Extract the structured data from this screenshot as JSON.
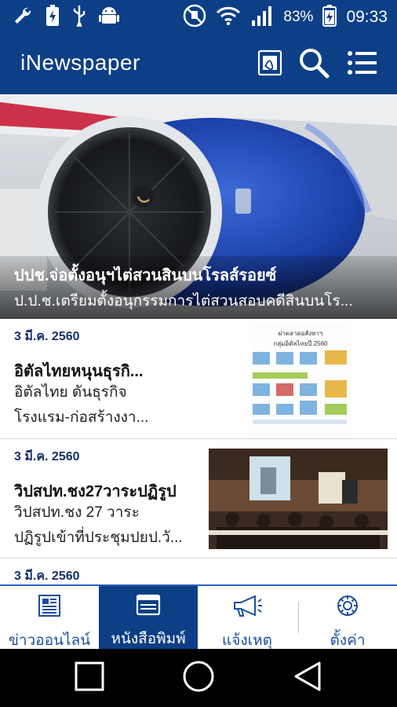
{
  "status_bar": {
    "battery_percent": "83%",
    "time": "09:33",
    "icons": [
      "wrench-icon",
      "battery-charging-icon",
      "usb-icon",
      "android-icon",
      "mute-icon",
      "wifi-icon",
      "signal-icon",
      "battery-icon"
    ]
  },
  "app_bar": {
    "title": "iNewspaper",
    "actions": [
      "pdf-icon",
      "search-icon",
      "menu-icon"
    ]
  },
  "hero": {
    "title": "ปปช.จ่อตั้งอนุฯไต่สวนสินบนโรลส์รอยซ์",
    "subtitle": "ป.ป.ช.เตรียมตั้งอนุกรรมการไต่สวนสอบคดีสินบนโร..."
  },
  "news": [
    {
      "date": "3 มี.ค. 2560",
      "title": "อิตัลไทยหนุนธุรกิ...",
      "desc_line1": "อิตัลไทย ดันธุรกิจ",
      "desc_line2": "โรงแรม-ก่อสร้างงา...",
      "thumb_title": "ผ่าตลาดอสังหาฯ",
      "thumb_sub": "กลุ่มอิตัลไทยปี 2560"
    },
    {
      "date": "3 มี.ค. 2560",
      "title": "วิปสปท.ชง27วาระปฏิรูป",
      "desc_line1": "วิปสปท.ชง 27 วาระ",
      "desc_line2": "ปฏิรูปเข้าที่ประชุมปยป.วั..."
    },
    {
      "date": "3 มี.ค. 2560"
    }
  ],
  "bottom_nav": [
    {
      "label": "ข่าวออนไลน์",
      "icon": "newspaper-icon",
      "active": false
    },
    {
      "label": "หนังสือพิมพ์",
      "icon": "browser-window-icon",
      "active": true
    },
    {
      "label": "แจ้งเหตุ",
      "icon": "megaphone-icon",
      "active": false
    },
    {
      "label": "ตั้งค่า",
      "icon": "settings-icon",
      "active": false
    }
  ],
  "system_nav": [
    "recents-icon",
    "home-icon",
    "back-icon"
  ],
  "colors": {
    "primary": "#0d3f86",
    "accent": "#2a62b8",
    "date_text": "#16306b"
  }
}
